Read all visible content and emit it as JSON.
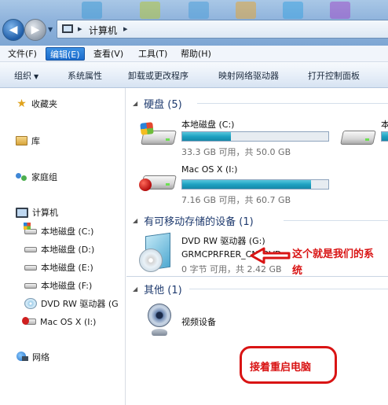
{
  "address_bar": {
    "path_label": "计算机",
    "separator": "▸"
  },
  "menu": {
    "items": [
      {
        "label": "文件(F)"
      },
      {
        "label": "编辑(E)",
        "active": true
      },
      {
        "label": "查看(V)"
      },
      {
        "label": "工具(T)"
      },
      {
        "label": "帮助(H)"
      }
    ]
  },
  "command_bar": {
    "organize": "组织",
    "system_properties": "系统属性",
    "uninstall": "卸载或更改程序",
    "map_drive": "映射网络驱动器",
    "control_panel": "打开控制面板"
  },
  "nav": {
    "favorites": "收藏夹",
    "libraries": "库",
    "homegroup": "家庭组",
    "computer": "计算机",
    "drives": [
      {
        "label": "本地磁盘 (C:)",
        "icon": "windows-drive-icon"
      },
      {
        "label": "本地磁盘 (D:)",
        "icon": "drive-icon"
      },
      {
        "label": "本地磁盘 (E:)",
        "icon": "drive-icon"
      },
      {
        "label": "本地磁盘 (F:)",
        "icon": "drive-icon"
      },
      {
        "label": "DVD RW 驱动器 (G",
        "icon": "dvd-icon"
      },
      {
        "label": "Mac OS X (I:)",
        "icon": "apple-drive-icon"
      }
    ],
    "network": "网络"
  },
  "content": {
    "hard_disks": {
      "header": "硬盘 (5)",
      "items": [
        {
          "name": "本地磁盘 (C:)",
          "detail": "33.3 GB 可用，共 50.0 GB",
          "used_fraction": 0.334
        },
        {
          "name": "本",
          "detail": "",
          "used_fraction": 0
        },
        {
          "name": "Mac OS X (I:)",
          "detail": "7.16 GB 可用，共 60.7 GB",
          "used_fraction": 0.882
        }
      ]
    },
    "removable": {
      "header": "有可移动存储的设备 (1)",
      "item_name_line1": "DVD RW 驱动器 (G:)",
      "item_name_line2": "GRMCPRFRER_CN_DVD",
      "item_detail": "0 字节 可用，共 2.42 GB"
    },
    "other": {
      "header": "其他 (1)",
      "item_name": "视频设备"
    }
  },
  "annotations": {
    "system_note_line1": "这个就是我们的系",
    "system_note_line2": "统",
    "restart_note": "接着重启电脑",
    "color": "#d91414"
  }
}
